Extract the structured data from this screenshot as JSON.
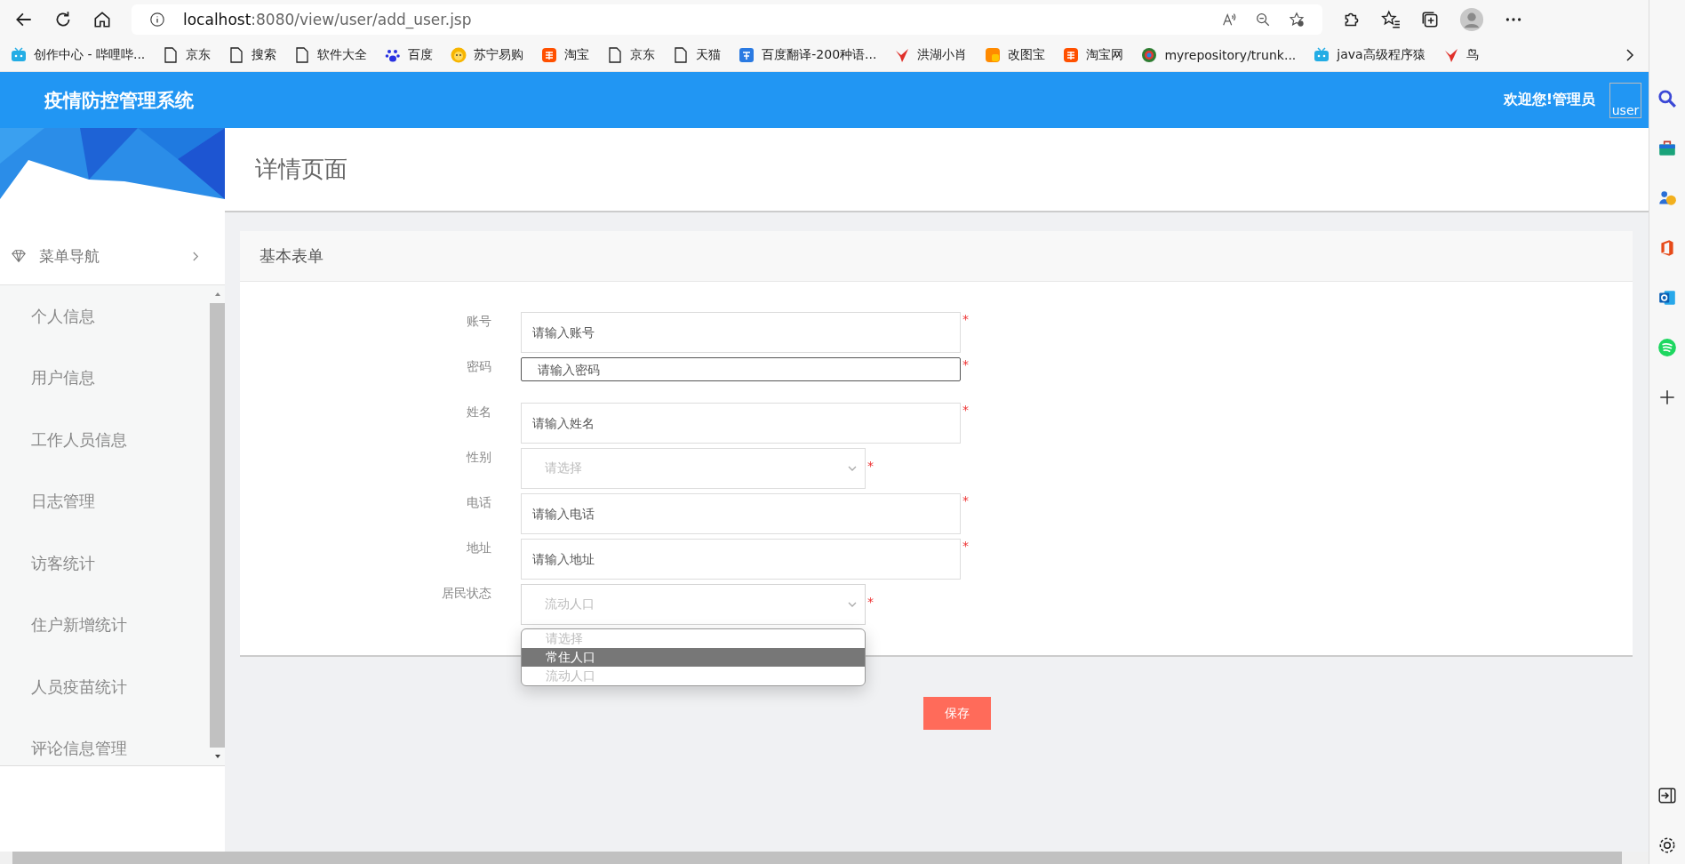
{
  "browser": {
    "url_host": "localhost",
    "url_rest": ":8080/view/user/add_user.jsp",
    "bookmarks": [
      {
        "kind": "tv",
        "label": "创作中心 - 哔哩哔..."
      },
      {
        "kind": "page",
        "label": "京东"
      },
      {
        "kind": "page",
        "label": "搜索"
      },
      {
        "kind": "page",
        "label": "软件大全"
      },
      {
        "kind": "paw",
        "label": "百度"
      },
      {
        "kind": "sun",
        "label": "苏宁易购"
      },
      {
        "kind": "tao",
        "label": "淘宝"
      },
      {
        "kind": "page",
        "label": "京东"
      },
      {
        "kind": "page",
        "label": "天猫"
      },
      {
        "kind": "translate",
        "label": "百度翻译-200种语..."
      },
      {
        "kind": "bird",
        "label": "洪湖小肖"
      },
      {
        "kind": "square",
        "label": "改图宝"
      },
      {
        "kind": "tao",
        "label": "淘宝网"
      },
      {
        "kind": "globe",
        "label": "myrepository/trunk..."
      },
      {
        "kind": "tv",
        "label": "java高级程序猿"
      },
      {
        "kind": "bird",
        "label": "鸟"
      }
    ]
  },
  "header": {
    "title": "疫情防控管理系统",
    "welcome": "欢迎您!管理员",
    "avatar_alt": "user"
  },
  "sidebar": {
    "nav_title": "菜单导航",
    "items": [
      {
        "label": "个人信息"
      },
      {
        "label": "用户信息"
      },
      {
        "label": "工作人员信息"
      },
      {
        "label": "日志管理"
      },
      {
        "label": "访客统计"
      },
      {
        "label": "住户新增统计"
      },
      {
        "label": "人员疫苗统计"
      },
      {
        "label": "评论信息管理"
      }
    ]
  },
  "page_title": "详情页面",
  "form": {
    "title": "基本表单",
    "fields": [
      {
        "kind": "text",
        "label": "账号",
        "placeholder": "请输入账号",
        "focused": false
      },
      {
        "kind": "text",
        "label": "密码",
        "placeholder": "请输入密码",
        "focused": true
      },
      {
        "kind": "text",
        "label": "姓名",
        "placeholder": "请输入姓名",
        "focused": false
      },
      {
        "kind": "select",
        "label": "性别",
        "value": "请选择"
      },
      {
        "kind": "text",
        "label": "电话",
        "placeholder": "请输入电话",
        "focused": false
      },
      {
        "kind": "text",
        "label": "地址",
        "placeholder": "请输入地址",
        "focused": false
      },
      {
        "kind": "select",
        "label": "居民状态",
        "value": "流动人口",
        "open": true,
        "options": [
          {
            "label": "请选择",
            "highlighted": false
          },
          {
            "label": "常住人口",
            "highlighted": true
          },
          {
            "label": "流动人口",
            "highlighted": false
          }
        ]
      }
    ],
    "required_mark": "*"
  },
  "save_button": "保存"
}
